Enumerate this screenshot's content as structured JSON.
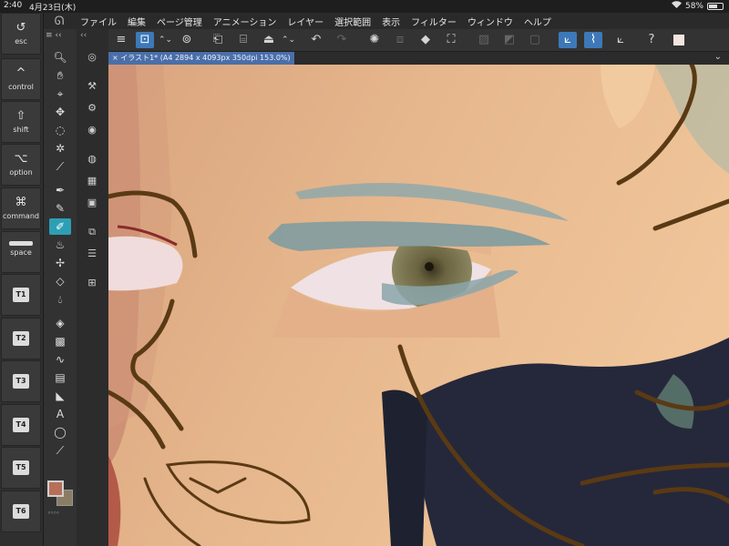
{
  "status": {
    "time": "2:40",
    "date": "4月23日(木)",
    "wifi": "wifi-icon",
    "battery": "58%"
  },
  "menu": [
    "ファイル",
    "編集",
    "ページ管理",
    "アニメーション",
    "レイヤー",
    "選択範囲",
    "表示",
    "フィルター",
    "ウィンドウ",
    "ヘルプ"
  ],
  "modifiers": [
    {
      "symbol": "↺",
      "label": "esc"
    },
    {
      "symbol": "^",
      "label": "control"
    },
    {
      "symbol": "⇧",
      "label": "shift"
    },
    {
      "symbol": "⌥",
      "label": "option"
    },
    {
      "symbol": "⌘",
      "label": "command"
    },
    {
      "symbol": "",
      "label": "space"
    }
  ],
  "tkeys": [
    "T1",
    "T2",
    "T3",
    "T4",
    "T5",
    "T6"
  ],
  "document_tab": "イラスト1* (A4 2894 x 4093px 350dpi 153.0%)",
  "colors": {
    "main": "#b76f5a",
    "sub": "#8a7d64",
    "accent": "#2d9fb4",
    "toolbar_active": "#3d79b8"
  }
}
